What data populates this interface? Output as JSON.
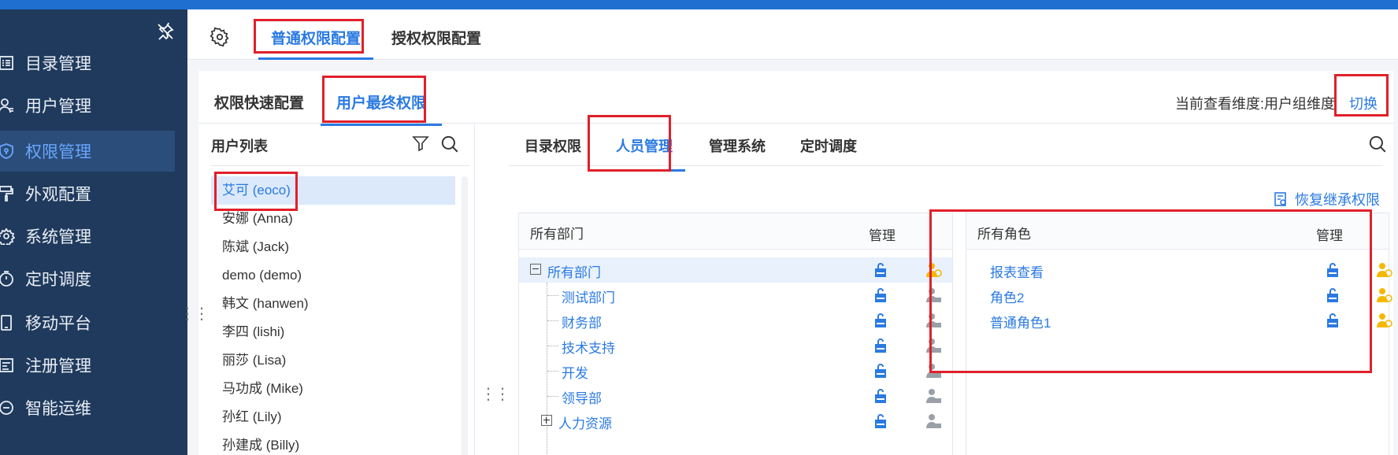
{
  "sidebar": {
    "items": [
      {
        "label": "目录管理",
        "icon": "list-icon"
      },
      {
        "label": "用户管理",
        "icon": "user-icon"
      },
      {
        "label": "权限管理",
        "icon": "shield-icon"
      },
      {
        "label": "外观配置",
        "icon": "paint-roller-icon"
      },
      {
        "label": "系统管理",
        "icon": "gear-icon"
      },
      {
        "label": "定时调度",
        "icon": "stopwatch-icon"
      },
      {
        "label": "移动平台",
        "icon": "mobile-icon"
      },
      {
        "label": "注册管理",
        "icon": "register-icon"
      },
      {
        "label": "智能运维",
        "icon": "ops-icon"
      }
    ],
    "active_index": 2
  },
  "top_tabs": {
    "tab1": "普通权限配置",
    "tab2": "授权权限配置"
  },
  "sub_tabs": {
    "tab1": "权限快速配置",
    "tab2": "用户最终权限"
  },
  "dimension": {
    "label": "当前查看维度:用户组维度",
    "switch": "切换"
  },
  "user_panel": {
    "title": "用户列表",
    "users": [
      "艾可 (eoco)",
      "安娜 (Anna)",
      "陈斌 (Jack)",
      "demo (demo)",
      "韩文 (hanwen)",
      "李四 (lishi)",
      "丽莎 (Lisa)",
      "马功成 (Mike)",
      "孙红 (Lily)",
      "孙建成 (Billy)"
    ]
  },
  "perm_tabs": {
    "tab1": "目录权限",
    "tab2": "人员管理",
    "tab3": "管理系统",
    "tab4": "定时调度"
  },
  "restore_label": "恢复继承权限",
  "dept_box": {
    "header": "所有部门",
    "manage": "管理",
    "root": "所有部门",
    "children": [
      "测试部门",
      "财务部",
      "技术支持",
      "开发",
      "领导部",
      "人力资源"
    ]
  },
  "role_box": {
    "header": "所有角色",
    "manage": "管理",
    "roles": [
      "报表查看",
      "角色2",
      "普通角色1"
    ]
  },
  "colors": {
    "accent": "#2a7ae2",
    "sidebar": "#1f3a5c",
    "highlight_box": "#e0202a",
    "role_icon": "#f5b800"
  }
}
